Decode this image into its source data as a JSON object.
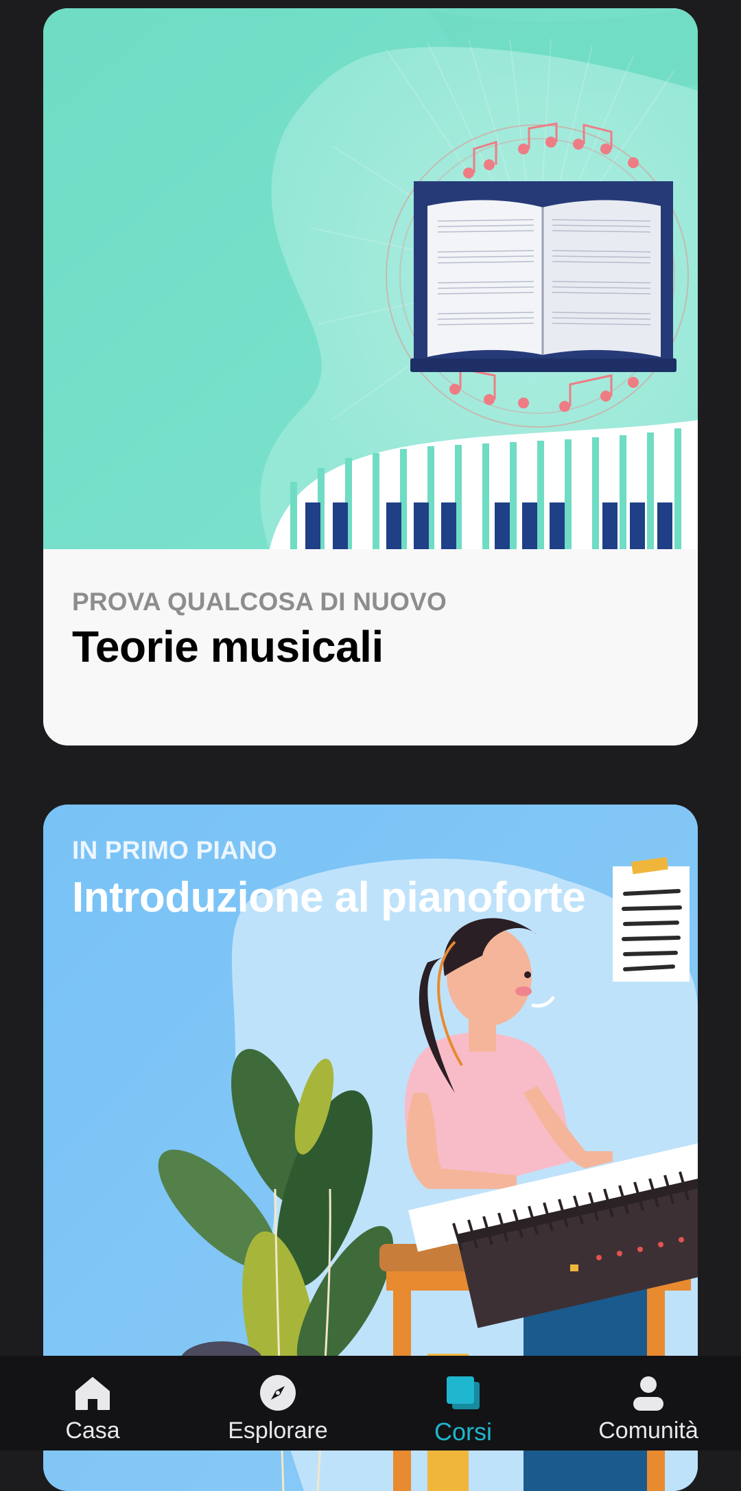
{
  "cards": [
    {
      "eyebrow": "PROVA QUALCOSA DI NUOVO",
      "title": "Teorie musicali",
      "image": "music-theory-book-piano-illustration",
      "colors": {
        "hero_bg": "#75dfc8",
        "body_bg": "#f8f8f8"
      }
    },
    {
      "eyebrow": "IN PRIMO PIANO",
      "title": "Introduzione al pianoforte",
      "image": "woman-playing-keyboard-illustration",
      "colors": {
        "hero_bg": "#82c6f6"
      }
    }
  ],
  "tabbar": {
    "items": [
      {
        "label": "Casa",
        "icon": "home-icon",
        "active": false
      },
      {
        "label": "Esplorare",
        "icon": "compass-icon",
        "active": false
      },
      {
        "label": "Corsi",
        "icon": "courses-icon",
        "active": true
      },
      {
        "label": "Comunità",
        "icon": "user-icon",
        "active": false
      }
    ],
    "colors": {
      "active": "#1fb6cf",
      "inactive": "#e9e9eb"
    }
  }
}
